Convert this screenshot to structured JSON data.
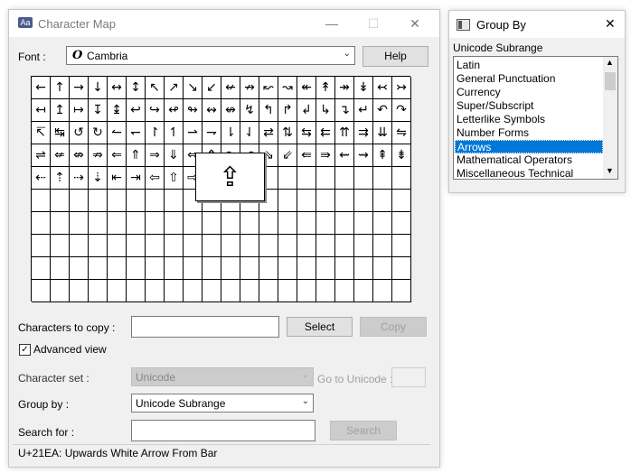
{
  "charmap": {
    "title": "Character Map",
    "font_label": "Font :",
    "font_value": "Cambria",
    "font_icon_glyph": "O",
    "help_label": "Help",
    "grid_rows": [
      [
        "←",
        "↑",
        "→",
        "↓",
        "↔",
        "↕",
        "↖",
        "↗",
        "↘",
        "↙",
        "↚",
        "↛",
        "↜",
        "↝",
        "↞",
        "↟",
        "↠",
        "↡",
        "↢",
        "↣"
      ],
      [
        "↤",
        "↥",
        "↦",
        "↧",
        "↨",
        "↩",
        "↪",
        "↫",
        "↬",
        "↭",
        "↮",
        "↯",
        "↰",
        "↱",
        "↲",
        "↳",
        "↴",
        "↵",
        "↶",
        "↷"
      ],
      [
        "↸",
        "↹",
        "↺",
        "↻",
        "↼",
        "↽",
        "↾",
        "↿",
        "⇀",
        "⇁",
        "⇂",
        "⇃",
        "⇄",
        "⇅",
        "⇆",
        "⇇",
        "⇈",
        "⇉",
        "⇊",
        "⇋"
      ],
      [
        "⇌",
        "⇍",
        "⇎",
        "⇏",
        "⇐",
        "⇑",
        "⇒",
        "⇓",
        "⇔",
        "⇕",
        "⇖",
        "⇗",
        "⇘",
        "⇙",
        "⇚",
        "⇛",
        "⇜",
        "⇝",
        "⇞",
        "⇟"
      ],
      [
        "⇠",
        "⇡",
        "⇢",
        "⇣",
        "⇤",
        "⇥",
        "⇦",
        "⇧",
        "⇨",
        "",
        "",
        "",
        "",
        "",
        "",
        "",
        "",
        "",
        "",
        ""
      ],
      [
        "",
        "",
        "",
        "",
        "",
        "",
        "",
        "",
        "",
        "",
        "",
        "",
        "",
        "",
        "",
        "",
        "",
        "",
        "",
        ""
      ],
      [
        "",
        "",
        "",
        "",
        "",
        "",
        "",
        "",
        "",
        "",
        "",
        "",
        "",
        "",
        "",
        "",
        "",
        "",
        "",
        ""
      ],
      [
        "",
        "",
        "",
        "",
        "",
        "",
        "",
        "",
        "",
        "",
        "",
        "",
        "",
        "",
        "",
        "",
        "",
        "",
        "",
        ""
      ],
      [
        "",
        "",
        "",
        "",
        "",
        "",
        "",
        "",
        "",
        "",
        "",
        "",
        "",
        "",
        "",
        "",
        "",
        "",
        "",
        ""
      ],
      [
        "",
        "",
        "",
        "",
        "",
        "",
        "",
        "",
        "",
        "",
        "",
        "",
        "",
        "",
        "",
        "",
        "",
        "",
        "",
        ""
      ]
    ],
    "zoom_glyph": "⇪",
    "chars_to_copy_label": "Characters to copy :",
    "chars_to_copy_value": "",
    "select_label": "Select",
    "copy_label": "Copy",
    "advanced_view_label": "Advanced view",
    "advanced_view_checked": true,
    "charset_label": "Character set :",
    "charset_value": "Unicode",
    "goto_unicode_label": "Go to Unicode :",
    "group_by_label": "Group by :",
    "group_by_value": "Unicode Subrange",
    "search_label": "Search for :",
    "search_value": "",
    "search_button": "Search",
    "status_text": "U+21EA: Upwards White Arrow From Bar"
  },
  "groupby": {
    "title": "Group By",
    "subtitle": "Unicode Subrange",
    "items": [
      "Latin",
      "General Punctuation",
      "Currency",
      "Super/Subscript",
      "Letterlike Symbols",
      "Number Forms",
      "Arrows",
      "Mathematical Operators",
      "Miscellaneous Technical"
    ],
    "selected": "Arrows"
  },
  "colors": {
    "selection": "#0078d7",
    "window_bg": "#f0f0f0"
  }
}
